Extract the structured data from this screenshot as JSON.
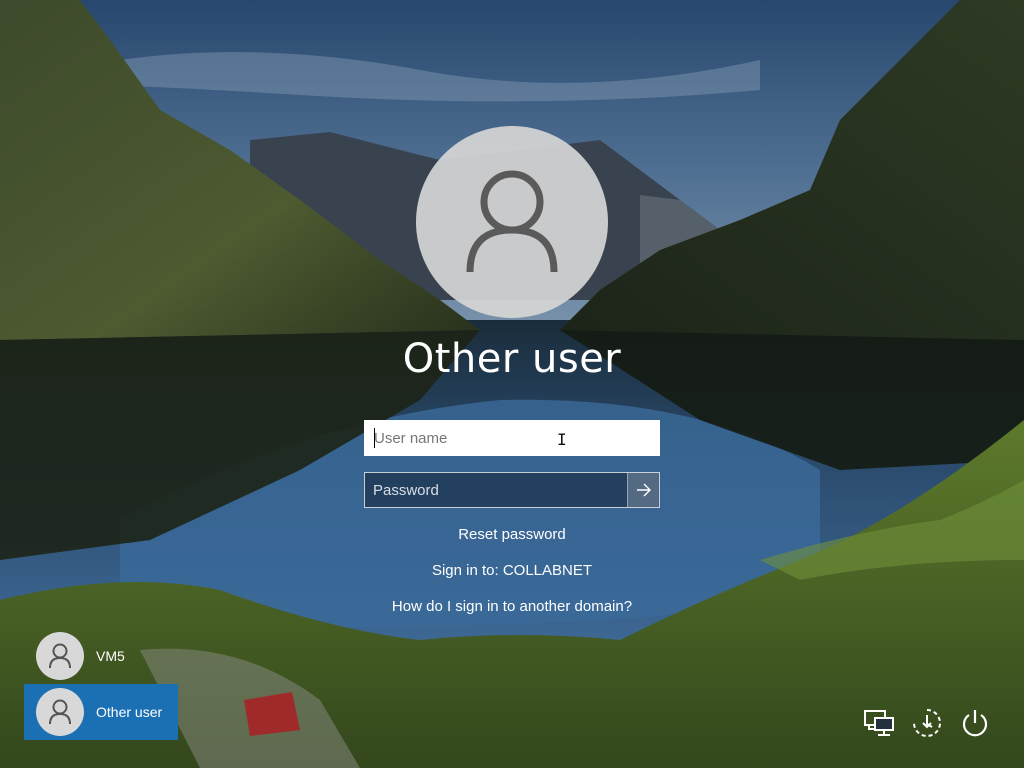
{
  "login": {
    "display_name": "Other user",
    "username_placeholder": "User name",
    "password_placeholder": "Password",
    "submit_icon": "arrow-right-icon",
    "reset_password": "Reset password",
    "sign_in_to": "Sign in to: COLLABNET",
    "domain_help": "How do I sign in to another domain?"
  },
  "users": [
    {
      "name": "VM5",
      "icon": "user-avatar-icon",
      "selected": false
    },
    {
      "name": "Other user",
      "icon": "user-avatar-icon",
      "selected": true
    }
  ],
  "system_icons": [
    "network-icon",
    "ease-of-access-icon",
    "power-icon"
  ],
  "colors": {
    "selected_tile": "#1b6fb3",
    "avatar_bg": "#d6d6d6"
  }
}
